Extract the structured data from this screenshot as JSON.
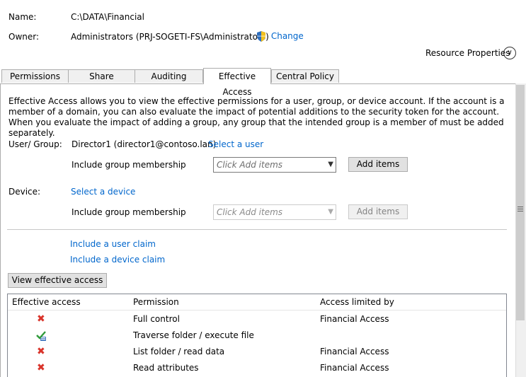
{
  "header": {
    "name_label": "Name:",
    "name_value": "C:\\DATA\\Financial",
    "owner_label": "Owner:",
    "owner_value": "Administrators (PRJ-SOGETI-FS\\Administrators)",
    "change_link": "Change",
    "resource_properties": "Resource Properties"
  },
  "tabs": [
    {
      "label": "Permissions",
      "active": false
    },
    {
      "label": "Share",
      "active": false
    },
    {
      "label": "Auditing",
      "active": false
    },
    {
      "label": "Effective Access",
      "active": true
    },
    {
      "label": "Central Policy",
      "active": false
    }
  ],
  "panel": {
    "description": "Effective Access allows you to view the effective permissions for a user, group, or device account. If the account is a member of a domain, you can also evaluate the impact of potential additions to the security token for the account. When you evaluate the impact of adding a group, any group that the intended group is a member of must be added separately.",
    "user_group_label": "User/ Group:",
    "user_group_value": "Director1 (director1@contoso.lan)",
    "select_user_link": "Select a user",
    "include_group_label": "Include group membership",
    "combo_placeholder": "Click Add items",
    "add_items_button": "Add items",
    "device_label": "Device:",
    "select_device_link": "Select a device",
    "device_include_group_label": "Include group membership",
    "device_combo_placeholder": "Click Add items",
    "device_add_items_button": "Add items",
    "include_user_claim": "Include a user claim",
    "include_device_claim": "Include a device claim",
    "view_button": "View effective access"
  },
  "grid": {
    "columns": [
      "Effective access",
      "Permission",
      "Access limited by"
    ],
    "rows": [
      {
        "access": "denied",
        "permission": "Full control",
        "limited_by": "Financial Access"
      },
      {
        "access": "allowed",
        "permission": "Traverse folder / execute file",
        "limited_by": ""
      },
      {
        "access": "denied",
        "permission": "List folder / read data",
        "limited_by": "Financial Access"
      },
      {
        "access": "denied",
        "permission": "Read attributes",
        "limited_by": "Financial Access"
      }
    ]
  },
  "icons": {
    "shield": "shield-icon",
    "denied": "red-x-icon",
    "allowed": "green-check-icon",
    "expand": "chevron-down-icon"
  }
}
